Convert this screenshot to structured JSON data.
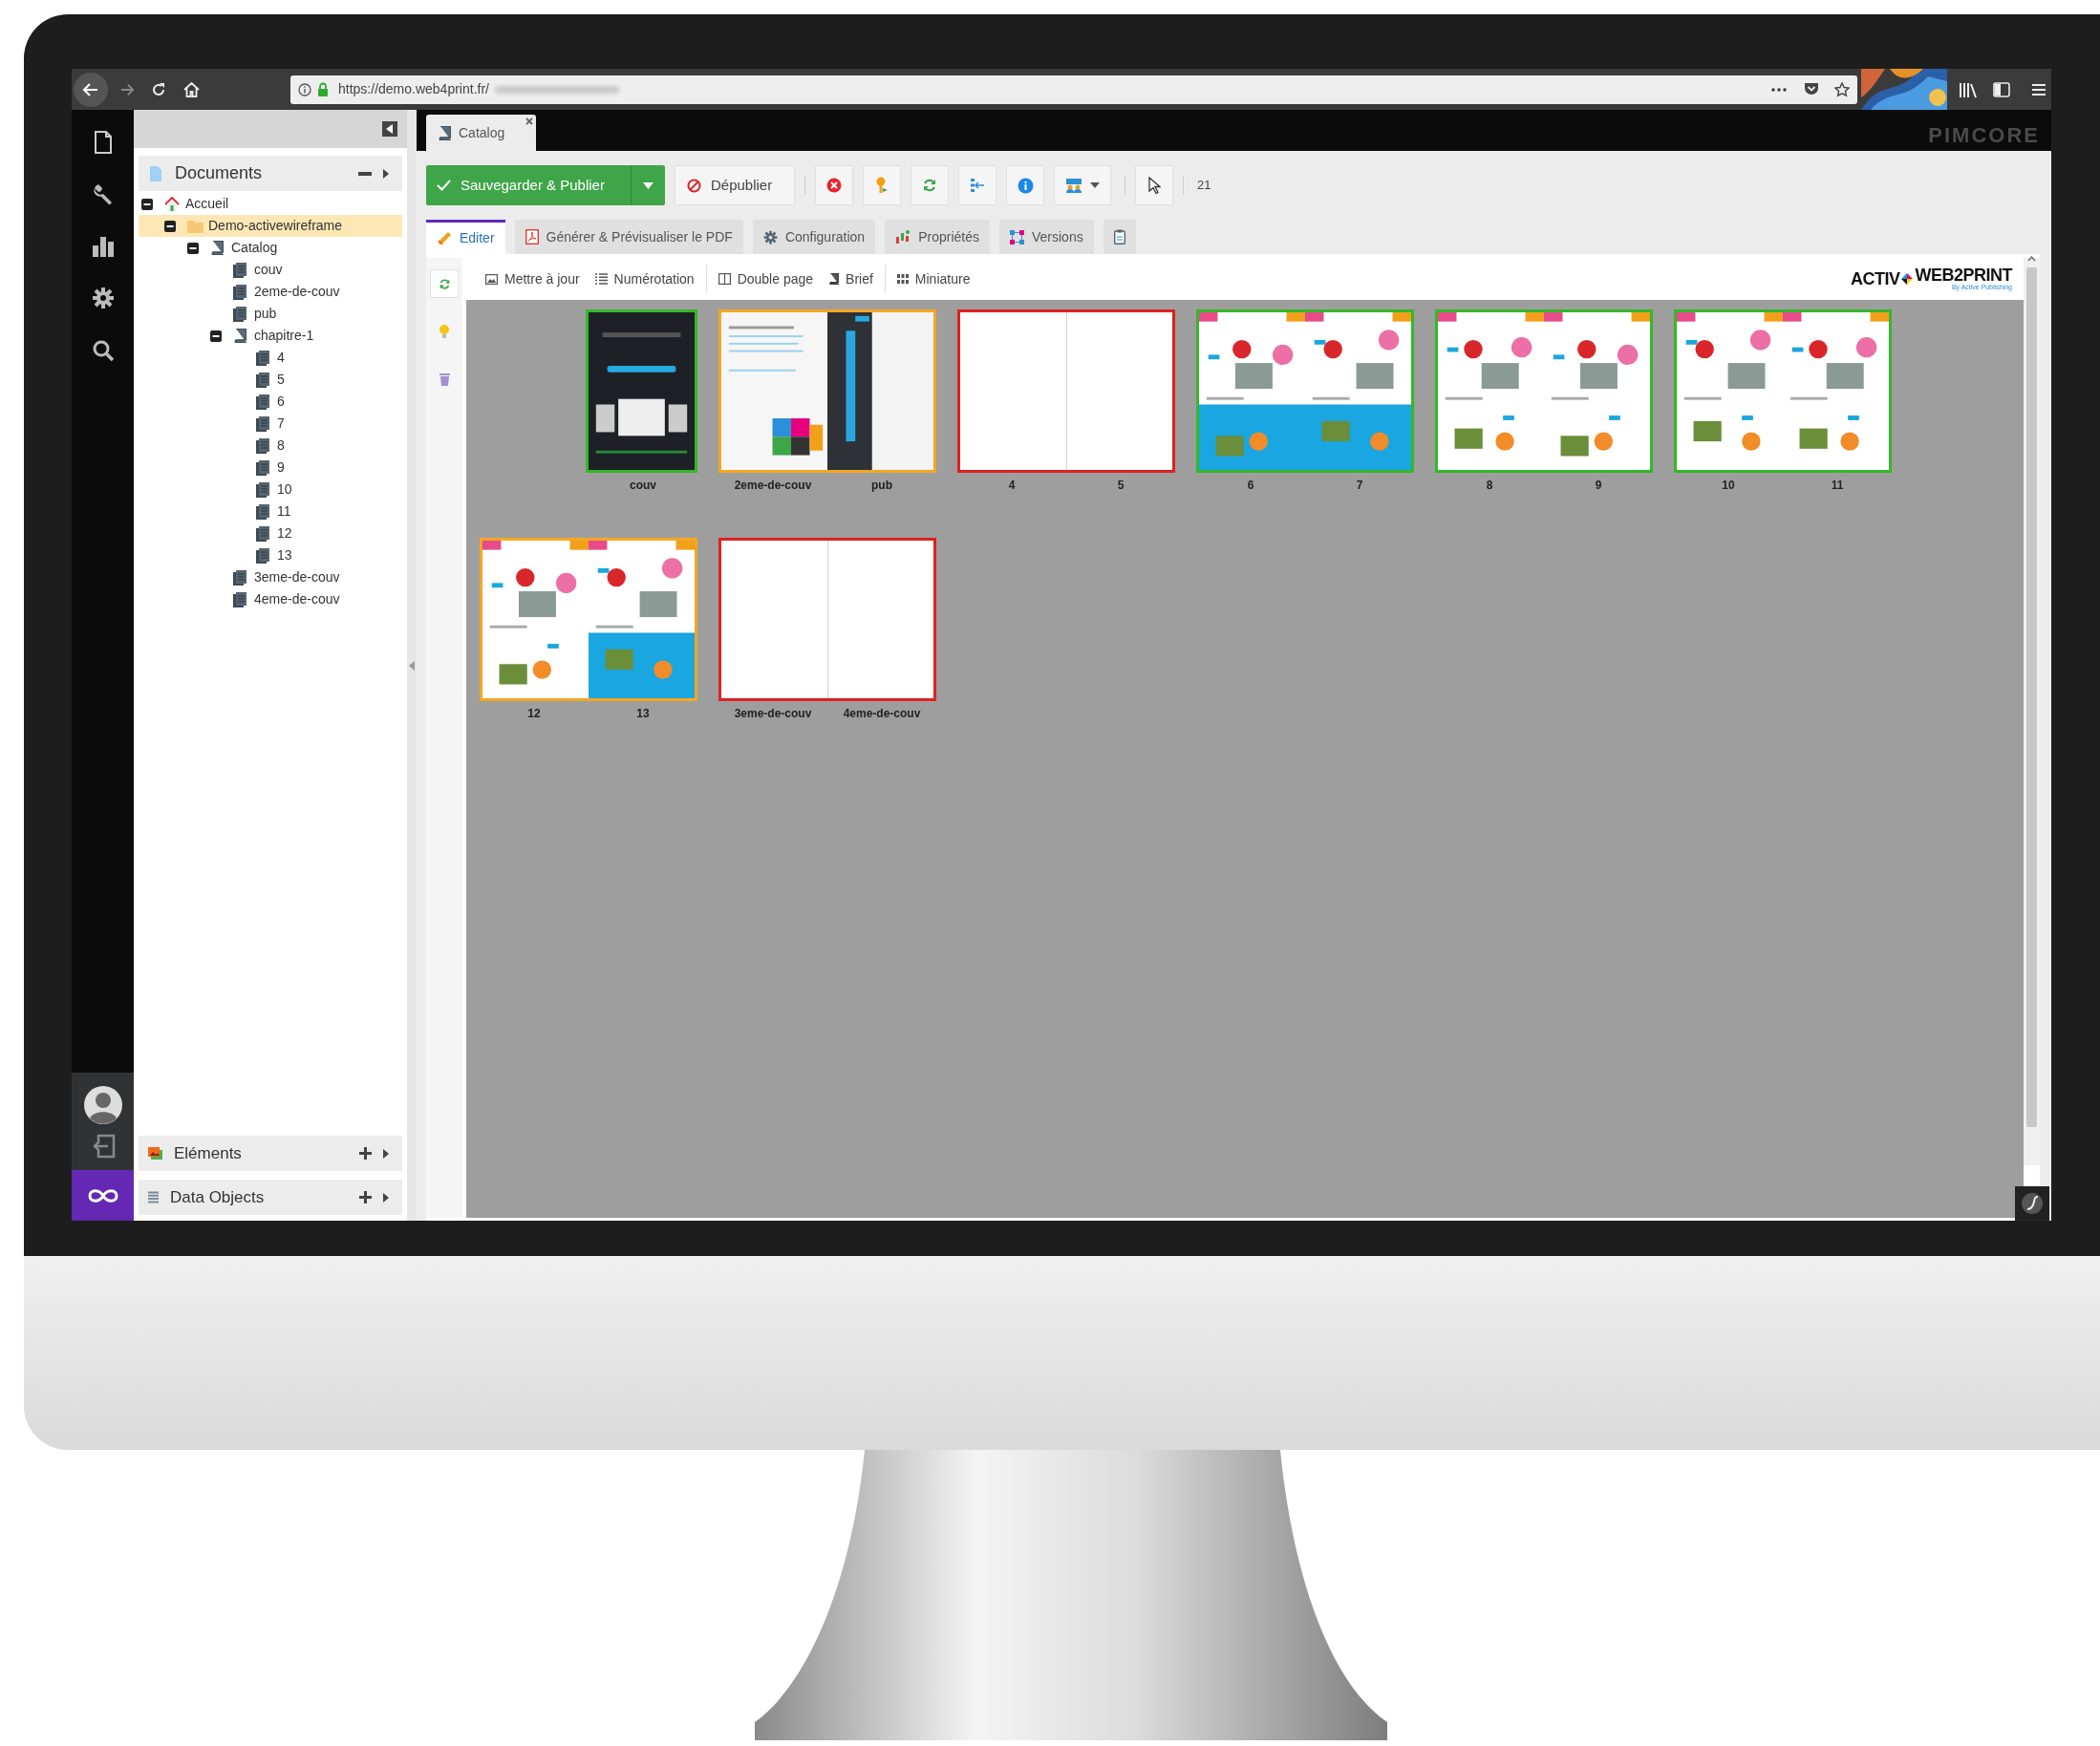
{
  "browser": {
    "url": "https://demo.web4print.fr/"
  },
  "tree_panel": {
    "title": "Documents",
    "nodes": [
      {
        "label": "Accueil",
        "kind": "home",
        "expanded": true,
        "selected": false,
        "children": [
          {
            "label": "Demo-activewireframe",
            "kind": "folder",
            "expanded": true,
            "selected": true,
            "children": [
              {
                "label": "Catalog",
                "kind": "book",
                "expanded": true,
                "selected": false,
                "children": [
                  {
                    "label": "couv",
                    "kind": "page",
                    "selected": false
                  },
                  {
                    "label": "2eme-de-couv",
                    "kind": "page",
                    "selected": false
                  },
                  {
                    "label": "pub",
                    "kind": "page",
                    "selected": false
                  },
                  {
                    "label": "chapitre-1",
                    "kind": "book",
                    "expanded": true,
                    "selected": false,
                    "children": [
                      {
                        "label": "4",
                        "kind": "page",
                        "selected": false
                      },
                      {
                        "label": "5",
                        "kind": "page",
                        "selected": false
                      },
                      {
                        "label": "6",
                        "kind": "page",
                        "selected": false
                      },
                      {
                        "label": "7",
                        "kind": "page",
                        "selected": false
                      },
                      {
                        "label": "8",
                        "kind": "page",
                        "selected": false
                      },
                      {
                        "label": "9",
                        "kind": "page",
                        "selected": false
                      },
                      {
                        "label": "10",
                        "kind": "page",
                        "selected": false
                      },
                      {
                        "label": "11",
                        "kind": "page",
                        "selected": false
                      },
                      {
                        "label": "12",
                        "kind": "page",
                        "selected": false
                      },
                      {
                        "label": "13",
                        "kind": "page",
                        "selected": false
                      }
                    ]
                  },
                  {
                    "label": "3eme-de-couv",
                    "kind": "page",
                    "selected": false
                  },
                  {
                    "label": "4eme-de-couv",
                    "kind": "page",
                    "selected": false
                  }
                ]
              }
            ]
          }
        ]
      }
    ]
  },
  "bottom_panels": [
    {
      "label": "Eléments"
    },
    {
      "label": "Data Objects"
    }
  ],
  "document_tab": {
    "label": "Catalog"
  },
  "brand": "PIMCORE",
  "toolbar": {
    "save": "Sauvegarder & Publier",
    "unpublish": "Dépublier",
    "page_count": "21"
  },
  "tabs": [
    {
      "label": "Editer",
      "selected": true
    },
    {
      "label": "Générer & Prévisualiser le PDF",
      "selected": false
    },
    {
      "label": "Configuration",
      "selected": false
    },
    {
      "label": "Propriétés",
      "selected": false
    },
    {
      "label": "Versions",
      "selected": false
    },
    {
      "selected": false
    }
  ],
  "subtoolbar": [
    {
      "label": "Mettre à jour"
    },
    {
      "label": "Numérotation"
    },
    {
      "label": "Double page"
    },
    {
      "label": "Brief"
    },
    {
      "label": "Miniature"
    }
  ],
  "logo": {
    "left": "ACTIV",
    "right": "WEB2PRINT",
    "tagline": "By Active Publishing"
  },
  "spreads": [
    {
      "kind": "single",
      "color": "#35b72a",
      "pages": [
        {
          "label": "couv",
          "kind": "cover"
        }
      ]
    },
    {
      "kind": "double",
      "color": "#f5a623",
      "pages": [
        {
          "label": "2eme-de-couv",
          "kind": "contents"
        },
        {
          "label": "pub",
          "kind": "band"
        }
      ]
    },
    {
      "kind": "double",
      "color": "#e02020",
      "pages": [
        {
          "label": "4",
          "kind": "blank"
        },
        {
          "label": "5",
          "kind": "blank"
        }
      ]
    },
    {
      "kind": "double",
      "color": "#35b72a",
      "pages": [
        {
          "label": "6",
          "kind": "catalog-blue"
        },
        {
          "label": "7",
          "kind": "catalog-blue"
        }
      ]
    },
    {
      "kind": "double",
      "color": "#35b72a",
      "pages": [
        {
          "label": "8",
          "kind": "catalog"
        },
        {
          "label": "9",
          "kind": "catalog"
        }
      ]
    },
    {
      "kind": "double",
      "color": "#35b72a",
      "pages": [
        {
          "label": "10",
          "kind": "catalog"
        },
        {
          "label": "11",
          "kind": "catalog"
        }
      ]
    },
    {
      "kind": "double",
      "color": "#f5a623",
      "pages": [
        {
          "label": "12",
          "kind": "catalog"
        },
        {
          "label": "13",
          "kind": "catalog-blue"
        }
      ]
    },
    {
      "kind": "double",
      "color": "#e02020",
      "pages": [
        {
          "label": "3eme-de-couv",
          "kind": "blank"
        },
        {
          "label": "4eme-de-couv",
          "kind": "blank"
        }
      ]
    }
  ]
}
